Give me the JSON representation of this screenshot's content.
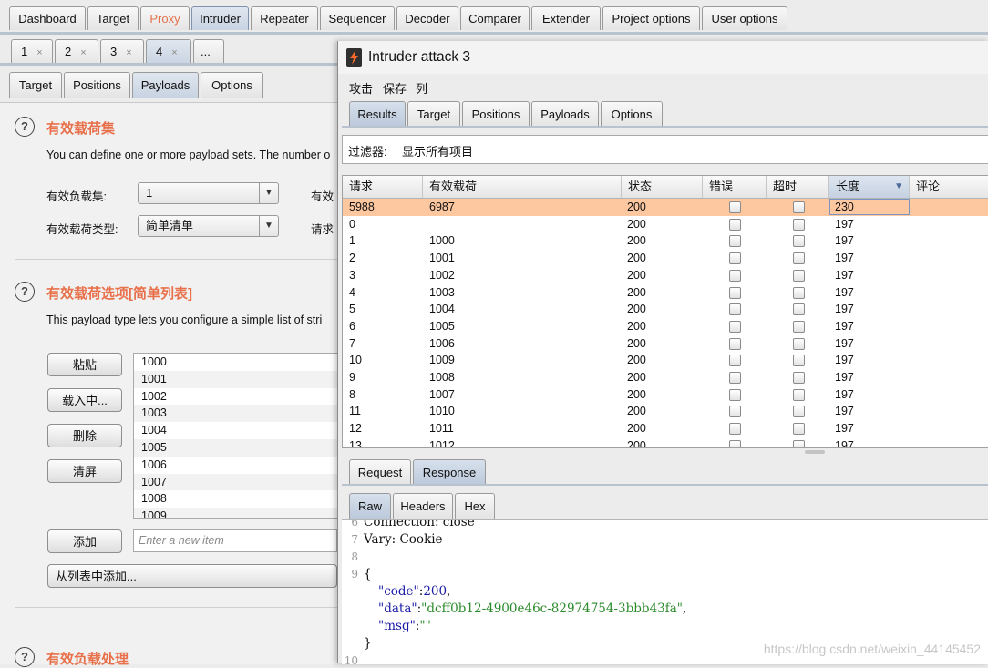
{
  "main_tabs": [
    "Dashboard",
    "Target",
    "Proxy",
    "Intruder",
    "Repeater",
    "Sequencer",
    "Decoder",
    "Comparer",
    "Extender",
    "Project options",
    "User options"
  ],
  "attack_tabs": [
    {
      "label": "1",
      "close": "×"
    },
    {
      "label": "2",
      "close": "×"
    },
    {
      "label": "3",
      "close": "×"
    },
    {
      "label": "4",
      "close": "×"
    },
    {
      "label": "..."
    }
  ],
  "intruder_subtabs": [
    "Target",
    "Positions",
    "Payloads",
    "Options"
  ],
  "payload_sets": {
    "help": "?",
    "title": "有效载荷集",
    "description": "You can define one or more payload sets. The number o",
    "set_label": "有效负载集:",
    "set_value": "1",
    "type_label": "有效载荷类型:",
    "type_value": "简单清单",
    "right_label1": "有效",
    "right_label2": "请求"
  },
  "payload_options": {
    "help": "?",
    "title": "有效载荷选项[简单列表]",
    "description": "This payload type lets you configure a simple list of stri",
    "buttons": {
      "paste": "粘贴",
      "load": "载入中...",
      "remove": "删除",
      "clear": "清屏",
      "add": "添加",
      "add_from_list": "从列表中添加..."
    },
    "items": [
      "1000",
      "1001",
      "1002",
      "1003",
      "1004",
      "1005",
      "1006",
      "1007",
      "1008",
      "1009"
    ],
    "new_item_placeholder": "Enter a new item"
  },
  "payload_processing": {
    "help": "?",
    "title": "有效负载处理"
  },
  "attack_window": {
    "title": "Intruder attack 3",
    "menu": [
      "攻击",
      "保存",
      "列"
    ],
    "tabs": [
      "Results",
      "Target",
      "Positions",
      "Payloads",
      "Options"
    ],
    "filter_label": "过滤器:",
    "filter_value": "显示所有项目",
    "columns": [
      "请求",
      "有效载荷",
      "状态",
      "错误",
      "超时",
      "长度",
      "评论"
    ],
    "sort_indicator": "▼",
    "rows": [
      {
        "req": "5988",
        "payload": "6987",
        "status": "200",
        "len": "230"
      },
      {
        "req": "0",
        "payload": "",
        "status": "200",
        "len": "197"
      },
      {
        "req": "1",
        "payload": "1000",
        "status": "200",
        "len": "197"
      },
      {
        "req": "2",
        "payload": "1001",
        "status": "200",
        "len": "197"
      },
      {
        "req": "3",
        "payload": "1002",
        "status": "200",
        "len": "197"
      },
      {
        "req": "4",
        "payload": "1003",
        "status": "200",
        "len": "197"
      },
      {
        "req": "5",
        "payload": "1004",
        "status": "200",
        "len": "197"
      },
      {
        "req": "6",
        "payload": "1005",
        "status": "200",
        "len": "197"
      },
      {
        "req": "7",
        "payload": "1006",
        "status": "200",
        "len": "197"
      },
      {
        "req": "10",
        "payload": "1009",
        "status": "200",
        "len": "197"
      },
      {
        "req": "9",
        "payload": "1008",
        "status": "200",
        "len": "197"
      },
      {
        "req": "8",
        "payload": "1007",
        "status": "200",
        "len": "197"
      },
      {
        "req": "11",
        "payload": "1010",
        "status": "200",
        "len": "197"
      },
      {
        "req": "12",
        "payload": "1011",
        "status": "200",
        "len": "197"
      },
      {
        "req": "13",
        "payload": "1012",
        "status": "200",
        "len": "197"
      }
    ],
    "selected_row": 0,
    "reqresp_tabs": [
      "Request",
      "Response"
    ],
    "view_tabs": [
      "Raw",
      "Headers",
      "Hex"
    ],
    "response_lines": [
      {
        "num": "6",
        "text": "Connection: close"
      },
      {
        "num": "7",
        "text": "Vary: Cookie"
      },
      {
        "num": "8",
        "text": ""
      },
      {
        "num": "9",
        "text": "{"
      },
      {
        "num": "",
        "key": "\"code\"",
        "sep": ":",
        "val": "200",
        "end": ","
      },
      {
        "num": "",
        "key": "\"data\"",
        "sep": ":",
        "val": "\"dcff0b12-4900e46c-82974754-3bbb43fa\"",
        "end": ","
      },
      {
        "num": "",
        "key": "\"msg\"",
        "sep": ":",
        "val": "\"\"",
        "end": ""
      },
      {
        "num": "",
        "text": "}"
      },
      {
        "num": "10",
        "text": ""
      }
    ]
  },
  "watermark": "https://blog.csdn.net/weixin_44145452",
  "colors": {
    "proxy_tab": "#e8714b",
    "section_title": "#e8714b",
    "selected_row": "#fdc8a0"
  }
}
